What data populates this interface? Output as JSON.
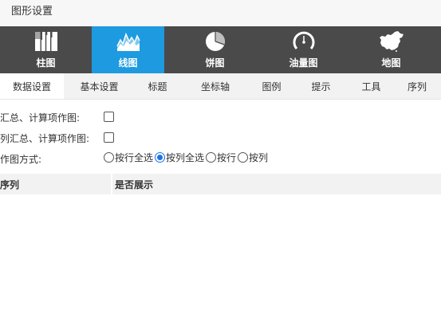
{
  "window": {
    "title": "图形设置"
  },
  "chart_types": [
    {
      "label": "柱图",
      "icon": "bar-chart-icon",
      "active": false
    },
    {
      "label": "线图",
      "icon": "line-chart-icon",
      "active": true
    },
    {
      "label": "饼图",
      "icon": "pie-chart-icon",
      "active": false
    },
    {
      "label": "油量图",
      "icon": "gauge-icon",
      "active": false
    },
    {
      "label": "地图",
      "icon": "china-map-icon",
      "active": false
    }
  ],
  "tabs": [
    "数据设置",
    "基本设置",
    "标题",
    "坐标轴",
    "图例",
    "提示",
    "工具",
    "序列"
  ],
  "active_tab": "数据设置",
  "form": {
    "summary_label": "汇总、计算项作图:",
    "summary_checked": false,
    "col_summary_label": "列汇总、计算项作图:",
    "col_summary_checked": false,
    "mode_label": "作图方式:",
    "mode_options": [
      "按行全选",
      "按列全选",
      "按行",
      "按列"
    ],
    "mode_selected": "按列全选"
  },
  "table": {
    "col1": "序列",
    "col2": "是否展示"
  },
  "colors": {
    "accent": "#1e9ae0",
    "toolbar_bg": "#4a4a4a"
  }
}
